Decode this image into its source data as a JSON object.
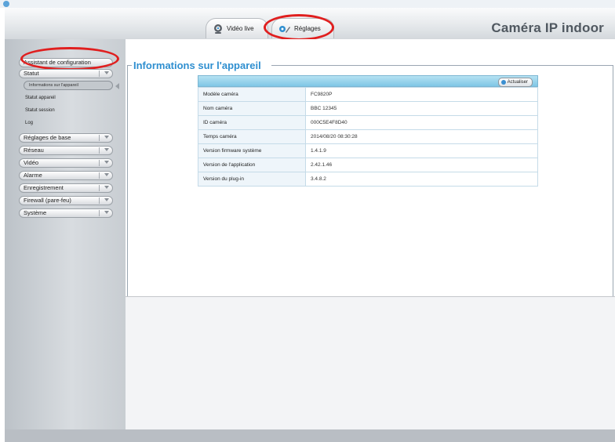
{
  "header": {
    "app_title": "Caméra IP indoor",
    "tabs": [
      {
        "label": "Vidéo live",
        "icon": "webcam-icon"
      },
      {
        "label": "Réglages",
        "icon": "gear-wrench-icon"
      }
    ]
  },
  "sidebar": {
    "items": [
      {
        "label": "Assistant de configuration"
      },
      {
        "label": "Statut",
        "children": [
          {
            "label": "Informations sur l'appareil",
            "active": true
          },
          {
            "label": "Statut appareil"
          },
          {
            "label": "Statut session"
          },
          {
            "label": "Log"
          }
        ]
      },
      {
        "label": "Réglages de base"
      },
      {
        "label": "Réseau"
      },
      {
        "label": "Vidéo"
      },
      {
        "label": "Alarme"
      },
      {
        "label": "Enregistrement"
      },
      {
        "label": "Firewall (pare-feu)"
      },
      {
        "label": "Système"
      }
    ]
  },
  "main": {
    "section_title": "Informations sur l'appareil",
    "refresh_label": "Actualiser",
    "rows": [
      {
        "key": "Modèle caméra",
        "value": "FC9820P"
      },
      {
        "key": "Nom caméra",
        "value": "BBC 12345"
      },
      {
        "key": "ID caméra",
        "value": "000C5E4F8D40"
      },
      {
        "key": "Temps caméra",
        "value": "2014/08/20 08:30:28"
      },
      {
        "key": "Version firmware système",
        "value": "1.4.1.9"
      },
      {
        "key": "Version de l'application",
        "value": "2.42.1.46"
      },
      {
        "key": "Version du plug-in",
        "value": "3.4.8.2"
      }
    ]
  },
  "colors": {
    "accent": "#2f8fd0",
    "highlight": "#e01f1f"
  }
}
